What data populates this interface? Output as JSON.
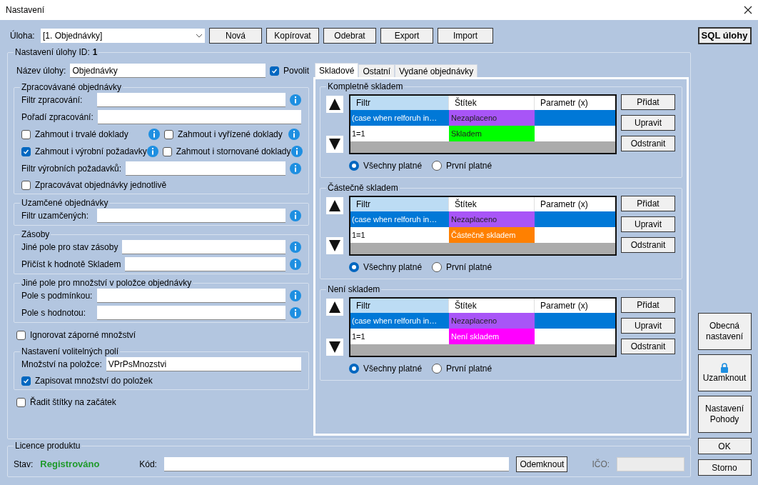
{
  "window": {
    "title": "Nastavení"
  },
  "task": {
    "label": "Úloha:",
    "value": "[1. Objednávky]"
  },
  "toolbar_buttons": [
    "Nová",
    "Kopírovat",
    "Odebrat",
    "Export",
    "Import"
  ],
  "sql_button": "SQL úlohy",
  "task_settings": {
    "title": "Nastavení úlohy ID:",
    "id": "1",
    "name_label": "Název úlohy:",
    "name_value": "Objednávky",
    "enable": {
      "label": "Povolit",
      "checked": true
    },
    "sections": [
      {
        "kind": "group",
        "title": "Zpracovávané objednávky",
        "rows": [
          {
            "kind": "field",
            "label": "Filtr zpracování:",
            "info": true
          },
          {
            "kind": "field",
            "label": "Pořadí zpracování:",
            "info": false
          },
          {
            "kind": "checks",
            "items": [
              {
                "label": "Zahmout i trvalé doklady",
                "checked": false,
                "info": true
              },
              {
                "label": "Zahmout i vyřízené doklady",
                "checked": false,
                "info": true
              }
            ]
          },
          {
            "kind": "checks",
            "items": [
              {
                "label": "Zahmout i výrobní požadavky",
                "checked": true,
                "info": true
              },
              {
                "label": "Zahmout i stornované doklady",
                "checked": false,
                "info": true
              }
            ]
          },
          {
            "kind": "field",
            "label": "Filtr výrobních požadavků:",
            "info": true
          },
          {
            "kind": "check",
            "label": "Zpracovávat objednávky jednotlivě",
            "checked": false
          }
        ]
      },
      {
        "kind": "group",
        "title": "Uzamčené objednávky",
        "rows": [
          {
            "kind": "field",
            "label": "Filtr uzamčených:",
            "info": true
          }
        ]
      },
      {
        "kind": "group",
        "title": "Zásoby",
        "rows": [
          {
            "kind": "field",
            "label": "Jiné pole pro stav zásoby",
            "info": true
          },
          {
            "kind": "field",
            "label": "Přičíst k hodnotě Skladem",
            "info": true
          }
        ]
      },
      {
        "kind": "group",
        "title": "Jiné pole pro množství v položce objednávky",
        "rows": [
          {
            "kind": "field",
            "label": "Pole s podmínkou:",
            "info": true
          },
          {
            "kind": "field",
            "label": "Pole s hodnotou:",
            "info": true
          }
        ]
      },
      {
        "kind": "check",
        "label": "Ignorovat záporné množství",
        "checked": false
      },
      {
        "kind": "group",
        "title": "Nastavení volitelných polí",
        "rows": [
          {
            "kind": "field",
            "label": "Množství na položce:",
            "value": "VPrPsMnozstvi",
            "info": false
          },
          {
            "kind": "check",
            "label": "Zapisovat množství do položek",
            "checked": true
          }
        ]
      },
      {
        "kind": "check",
        "label": "Řadit štítky na začátek",
        "checked": false
      }
    ],
    "tabs": [
      {
        "label": "Skladové",
        "selected": true
      },
      {
        "label": "Ostatní",
        "selected": false
      },
      {
        "label": "Vydané objednávky",
        "selected": false
      }
    ],
    "stock_groups": [
      {
        "title": "Kompletně skladem",
        "columns": [
          {
            "label": "Filtr",
            "highlighted": true
          },
          {
            "label": "Štítek",
            "highlighted": false
          },
          {
            "label": "Parametr (x)",
            "highlighted": false
          }
        ],
        "rows": [
          {
            "cells": [
              "(case when relforuh in…",
              "Nezaplaceno"
            ],
            "color": "#a855f7",
            "selected": true
          },
          {
            "cells": [
              "1=1",
              "Skladem"
            ],
            "color": "#00ff00",
            "selected": false
          }
        ],
        "buttons": [
          "Přidat",
          "Upravit",
          "Odstranit"
        ],
        "options": [
          {
            "label": "Všechny platné",
            "selected": true
          },
          {
            "label": "První platné",
            "selected": false
          }
        ]
      },
      {
        "title": "Částečně skladem",
        "columns": [
          {
            "label": "Filtr",
            "highlighted": true
          },
          {
            "label": "Štítek",
            "highlighted": false
          },
          {
            "label": "Parametr (x)",
            "highlighted": false
          }
        ],
        "rows": [
          {
            "cells": [
              "(case when relforuh in…",
              "Nezaplaceno"
            ],
            "color": "#a855f7",
            "selected": true
          },
          {
            "cells": [
              "1=1",
              "Částečně skladem"
            ],
            "color": "#ff8000",
            "selected": false
          }
        ],
        "buttons": [
          "Přidat",
          "Upravit",
          "Odstranit"
        ],
        "options": [
          {
            "label": "Všechny platné",
            "selected": true
          },
          {
            "label": "První platné",
            "selected": false
          }
        ]
      },
      {
        "title": "Není skladem",
        "columns": [
          {
            "label": "Filtr",
            "highlighted": true
          },
          {
            "label": "Štítek",
            "highlighted": false
          },
          {
            "label": "Parametr (x)",
            "highlighted": false
          }
        ],
        "rows": [
          {
            "cells": [
              "(case when relforuh in…",
              "Nezaplaceno"
            ],
            "color": "#a855f7",
            "selected": true
          },
          {
            "cells": [
              "1=1",
              "Není skladem"
            ],
            "color": "#ff00ff",
            "selected": false
          }
        ],
        "buttons": [
          "Přidat",
          "Upravit",
          "Odstranit"
        ],
        "options": [
          {
            "label": "Všechny platné",
            "selected": true
          },
          {
            "label": "První platné",
            "selected": false
          }
        ]
      }
    ]
  },
  "side_buttons": [
    {
      "kind": "text",
      "label": "Obecná nastavení"
    },
    {
      "kind": "lock",
      "label": "Uzamknout"
    },
    {
      "kind": "text",
      "label": "Nastavení Pohody"
    }
  ],
  "dialog_buttons": [
    "OK",
    "Storno"
  ],
  "license": {
    "title": "Licence produktu",
    "status_label": "Stav:",
    "status": "Registrováno",
    "code_label": "Kód:",
    "unlock_button": "Odemknout",
    "ico_label": "IČO:"
  }
}
